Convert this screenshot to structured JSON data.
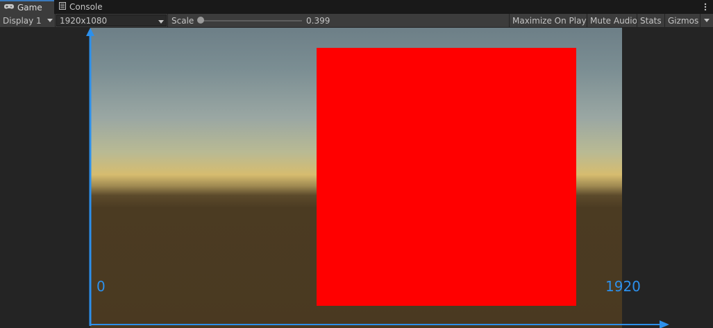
{
  "tabs": [
    {
      "label": "Game",
      "icon": "gamepad-icon",
      "active": true
    },
    {
      "label": "Console",
      "icon": "console-icon",
      "active": false
    }
  ],
  "toolbar": {
    "display_label": "Display 1",
    "resolution_label": "1920x1080",
    "scale_label": "Scale",
    "scale_value": "0.399",
    "maximize_label": "Maximize On Play",
    "mute_label": "Mute Audio",
    "stats_label": "Stats",
    "gizmos_label": "Gizmos"
  },
  "viewport": {
    "axis_start_label": "0",
    "axis_end_label": "1920"
  },
  "colors": {
    "accent": "#2c90ec",
    "square": "#ff0000"
  }
}
